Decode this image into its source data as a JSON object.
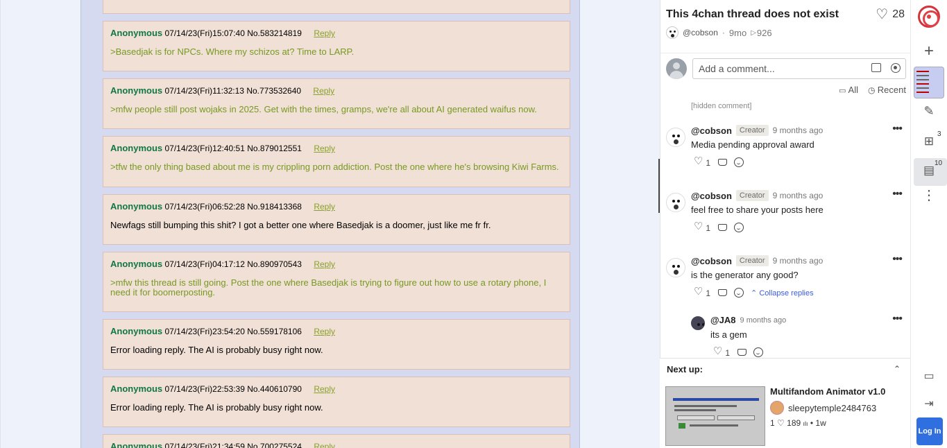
{
  "thread": {
    "posts": [
      {
        "name": "Anonymous",
        "date": "07/14/23(Fri)15:07:40",
        "no": "No.583214819",
        "reply": "Reply",
        "text": ">Basedjak is for NPCs. Where my schizos at? Time to LARP.",
        "greentext": true
      },
      {
        "name": "Anonymous",
        "date": "07/14/23(Fri)11:32:13",
        "no": "No.773532640",
        "reply": "Reply",
        "text": ">mfw people still post wojaks in 2025. Get with the times, gramps, we're all about AI generated waifus now.",
        "greentext": true
      },
      {
        "name": "Anonymous",
        "date": "07/14/23(Fri)12:40:51",
        "no": "No.879012551",
        "reply": "Reply",
        "text": ">tfw the only thing based about me is my crippling porn addiction. Post the one where he's browsing Kiwi Farms.",
        "greentext": true
      },
      {
        "name": "Anonymous",
        "date": "07/14/23(Fri)06:52:28",
        "no": "No.918413368",
        "reply": "Reply",
        "text": "Newfags still bumping this shit? I got a better one where Basedjak is a doomer, just like me fr fr.",
        "greentext": false
      },
      {
        "name": "Anonymous",
        "date": "07/14/23(Fri)04:17:12",
        "no": "No.890970543",
        "reply": "Reply",
        "text": ">mfw this thread is still going. Post the one where Basedjak is trying to figure out how to use a rotary phone, I need it for boomerposting.",
        "greentext": true
      },
      {
        "name": "Anonymous",
        "date": "07/14/23(Fri)23:54:20",
        "no": "No.559178106",
        "reply": "Reply",
        "text": "Error loading reply. The AI is probably busy right now.",
        "greentext": false
      },
      {
        "name": "Anonymous",
        "date": "07/14/23(Fri)22:53:39",
        "no": "No.440610790",
        "reply": "Reply",
        "text": "Error loading reply. The AI is probably busy right now.",
        "greentext": false
      },
      {
        "name": "Anonymous",
        "date": "07/14/23(Fri)21:34:59",
        "no": "No.700275524",
        "reply": "Reply",
        "text": "",
        "greentext": false
      }
    ]
  },
  "panel": {
    "title": "This 4chan thread does not exist",
    "likes": "28",
    "author": "@cobson",
    "age": "9mo",
    "views": "926",
    "comment_placeholder": "Add a comment...",
    "filter_all": "All",
    "filter_recent": "Recent",
    "hidden_comment": "[hidden comment]",
    "comments": [
      {
        "user": "@cobson",
        "badge": "Creator",
        "time": "9 months ago",
        "text": "Media pending approval award",
        "likes": "1"
      },
      {
        "user": "@cobson",
        "badge": "Creator",
        "time": "9 months ago",
        "text": "feel free to share your posts here",
        "likes": "1"
      },
      {
        "user": "@cobson",
        "badge": "Creator",
        "time": "9 months ago",
        "text": "is the generator any good?",
        "likes": "1",
        "collapse": "Collapse replies"
      }
    ],
    "reply": {
      "user": "@JA8",
      "time": "9 months ago",
      "text": "its a gem",
      "likes": "1"
    }
  },
  "nextup": {
    "label": "Next up:",
    "title": "Multifandom Animator v1.0",
    "user": "sleepytemple2484763",
    "likes": "1",
    "views": "189",
    "age": "1w"
  },
  "rail": {
    "badge_remix": "3",
    "badge_comments": "10",
    "login": "Log In"
  }
}
